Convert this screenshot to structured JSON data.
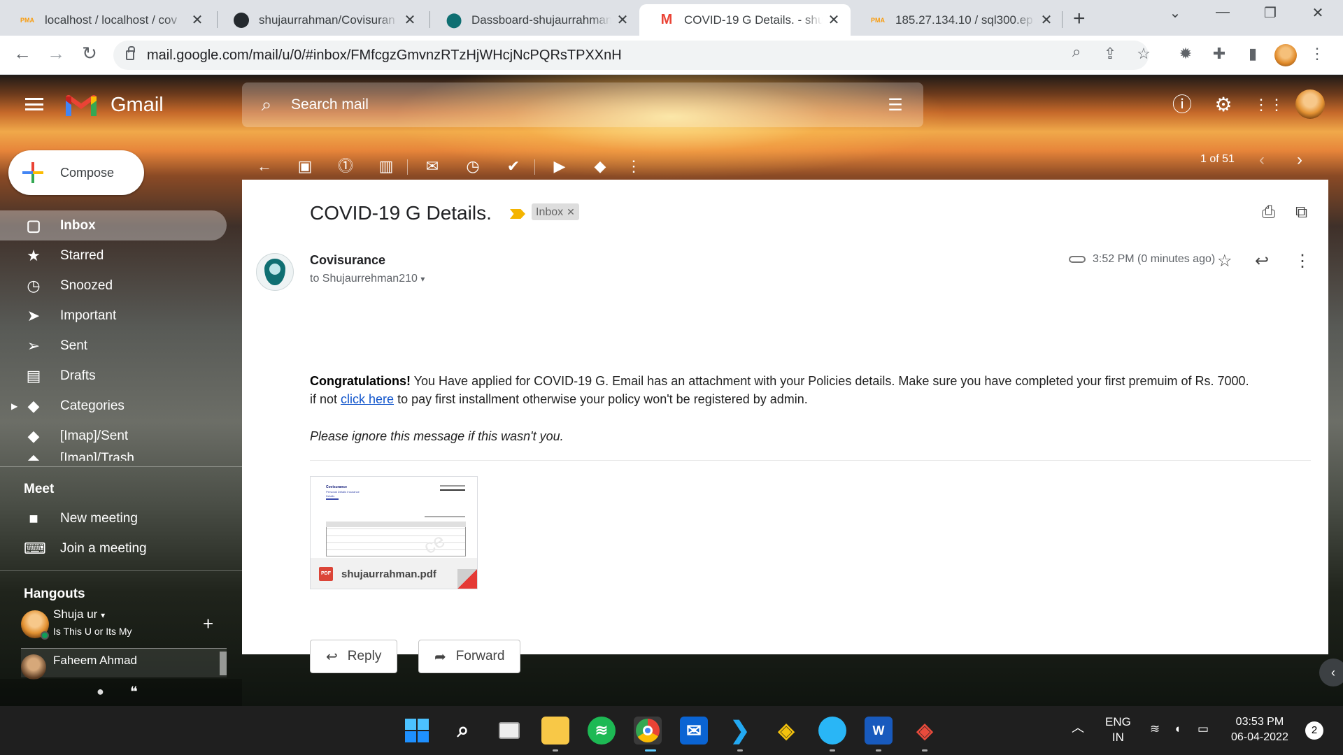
{
  "browser": {
    "tabs": [
      {
        "title": "localhost / localhost / cov",
        "icon": "phpmyadmin-icon",
        "fav": "PMA"
      },
      {
        "title": "shujaurrahman/Covisuran",
        "icon": "github-icon",
        "fav": ""
      },
      {
        "title": "Dassboard-shujaurrahman",
        "icon": "location-pin-icon",
        "fav": ""
      },
      {
        "title": "COVID-19 G Details. - shu",
        "icon": "gmail-icon",
        "fav": "M"
      },
      {
        "title": "185.27.134.10 / sql300.ep",
        "icon": "phpmyadmin-icon",
        "fav": "PMA"
      }
    ],
    "url": "mail.google.com/mail/u/0/#inbox/FMfcgzGmvnzRTzHjWHcjNcPQRsTPXXnH"
  },
  "gmail": {
    "brand": "Gmail",
    "search_placeholder": "Search mail",
    "compose": "Compose",
    "nav": [
      {
        "label": "Inbox",
        "icon": "inbox-icon",
        "glyph": "▢",
        "active": true
      },
      {
        "label": "Starred",
        "icon": "star-icon",
        "glyph": "★"
      },
      {
        "label": "Snoozed",
        "icon": "clock-icon",
        "glyph": "◷"
      },
      {
        "label": "Important",
        "icon": "important-icon",
        "glyph": "➤"
      },
      {
        "label": "Sent",
        "icon": "send-icon",
        "glyph": "➢"
      },
      {
        "label": "Drafts",
        "icon": "draft-icon",
        "glyph": "▤"
      },
      {
        "label": "Categories",
        "icon": "label-icon",
        "glyph": "◆"
      },
      {
        "label": "[Imap]/Sent",
        "icon": "label-icon",
        "glyph": "◆"
      }
    ],
    "nav_cut": "[Imap]/Trash",
    "meet": {
      "title": "Meet",
      "new_meeting": "New meeting",
      "join": "Join a meeting"
    },
    "hangouts": {
      "title": "Hangouts",
      "user_name": "Shuja ur",
      "user_status": "Is This U or Its My",
      "contact": "Faheem Ahmad"
    },
    "pager": "1 of 51"
  },
  "email": {
    "subject": "COVID-19 G Details.",
    "label": "Inbox",
    "sender": "Covisurance",
    "to": "to Shujaurrehman210",
    "time": "3:52 PM (0 minutes ago)",
    "body_bold": "Congratulations!",
    "body_1": " You Have applied for COVID-19 G. Email has an attachment with your Policies details. Make sure you have completed your first premuim of Rs. 7000.",
    "body_2a": "if not ",
    "body_link": "click here",
    "body_2b": " to pay first installment otherwise your policy won't be registered by admin.",
    "note": "Please ignore this message if this wasn't you.",
    "attachment": {
      "name": "shujaurrahman.pdf",
      "type": "PDF",
      "preview_heading": "Covisurance",
      "preview_lines": [
        "Personal Details Insurance",
        "Details"
      ]
    },
    "reply": "Reply",
    "forward": "Forward"
  },
  "taskbar": {
    "lang1": "ENG",
    "lang2": "IN",
    "time": "03:53 PM",
    "date": "06-04-2022",
    "badge": "2"
  }
}
